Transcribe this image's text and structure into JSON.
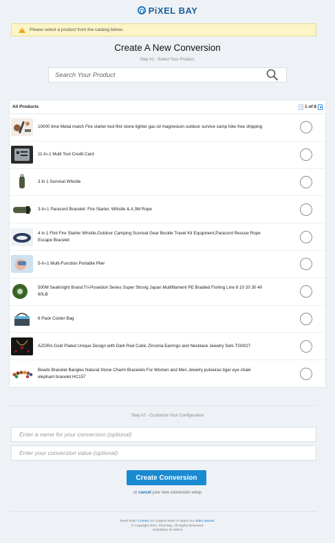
{
  "brand": {
    "name": "PiXEL BAY"
  },
  "alert": {
    "message": "Please select a product from the catalog below."
  },
  "page": {
    "title": "Create A New Conversion",
    "step1": "Step #1 - Select Your Product."
  },
  "search": {
    "placeholder": "Search Your Product"
  },
  "products_panel": {
    "header": "All Products",
    "pager": {
      "current": "1",
      "separator": "of",
      "total": "6",
      "text": "1 of 6"
    },
    "items": [
      {
        "name": "10000 time Metal match Fire starter tool flint stone lighter gas oil magnesium outdoor survive camp hike free shipping",
        "icon": "fire-starter-icon"
      },
      {
        "name": "11-In-1 Multi Tool Credit Card",
        "icon": "multitool-card-icon"
      },
      {
        "name": "3 In 1 Survival Whistle",
        "icon": "whistle-icon"
      },
      {
        "name": "3-In-1 Paracord Bracelet: Fire Starter, Whistle & A 3M Rope",
        "icon": "paracord-icon"
      },
      {
        "name": "4 in 1 Flint Fire Starter Whistle,Outdoor Camping Survival Gear Buckle Travel Kit Equipment,Paracord Rescue Rope Escape Bracelet",
        "icon": "bracelet-icon"
      },
      {
        "name": "5-In-1 Multi-Function Portable Plier",
        "icon": "plier-icon"
      },
      {
        "name": "500M SeaKnight Brand Tri-Poseidon Series Super Strong Japan Multifilament PE Braided Fishing Line 8 10 20 30 40 60LB",
        "icon": "fishing-line-icon"
      },
      {
        "name": "6 Pack Cooler Bag",
        "icon": "cooler-bag-icon"
      },
      {
        "name": "AZORA Gold Plated Unique Design with Dark Red Cubic Zirconia Earrings and Necklace Jewelry Sets TG0027",
        "icon": "jewelry-icon"
      },
      {
        "name": "Beads Bracelet Bangles Natural Stone Charm Bracelets For Women and Men Jewelry pulseiras tiger eye chakr elephant bracelet HC157",
        "icon": "beads-icon"
      }
    ]
  },
  "step2": {
    "label": "Step #2 - Customize Your Configuration",
    "name_placeholder": "Enter a name for your conversion (optional)",
    "value_placeholder": "Enter your conversion value (optional)"
  },
  "actions": {
    "create_label": "Create Conversion",
    "or_text": "or",
    "cancel_label": "cancel",
    "cancel_suffix": "your new conversion setup"
  },
  "footer": {
    "help_prefix": "Need help?",
    "contact_label": "Contact",
    "help_middle": "our support team or watch our",
    "tutorial_label": "video tutorial",
    "help_end": ".",
    "copyright": "© Copyright 2017, Pixel Bay. All Rights Reserved.",
    "subsidiary": "Subsidiary of Adtrics"
  },
  "colors": {
    "accent": "#1a8ad2",
    "alert_bg": "#fcf5c7",
    "background": "#eef2f6"
  }
}
